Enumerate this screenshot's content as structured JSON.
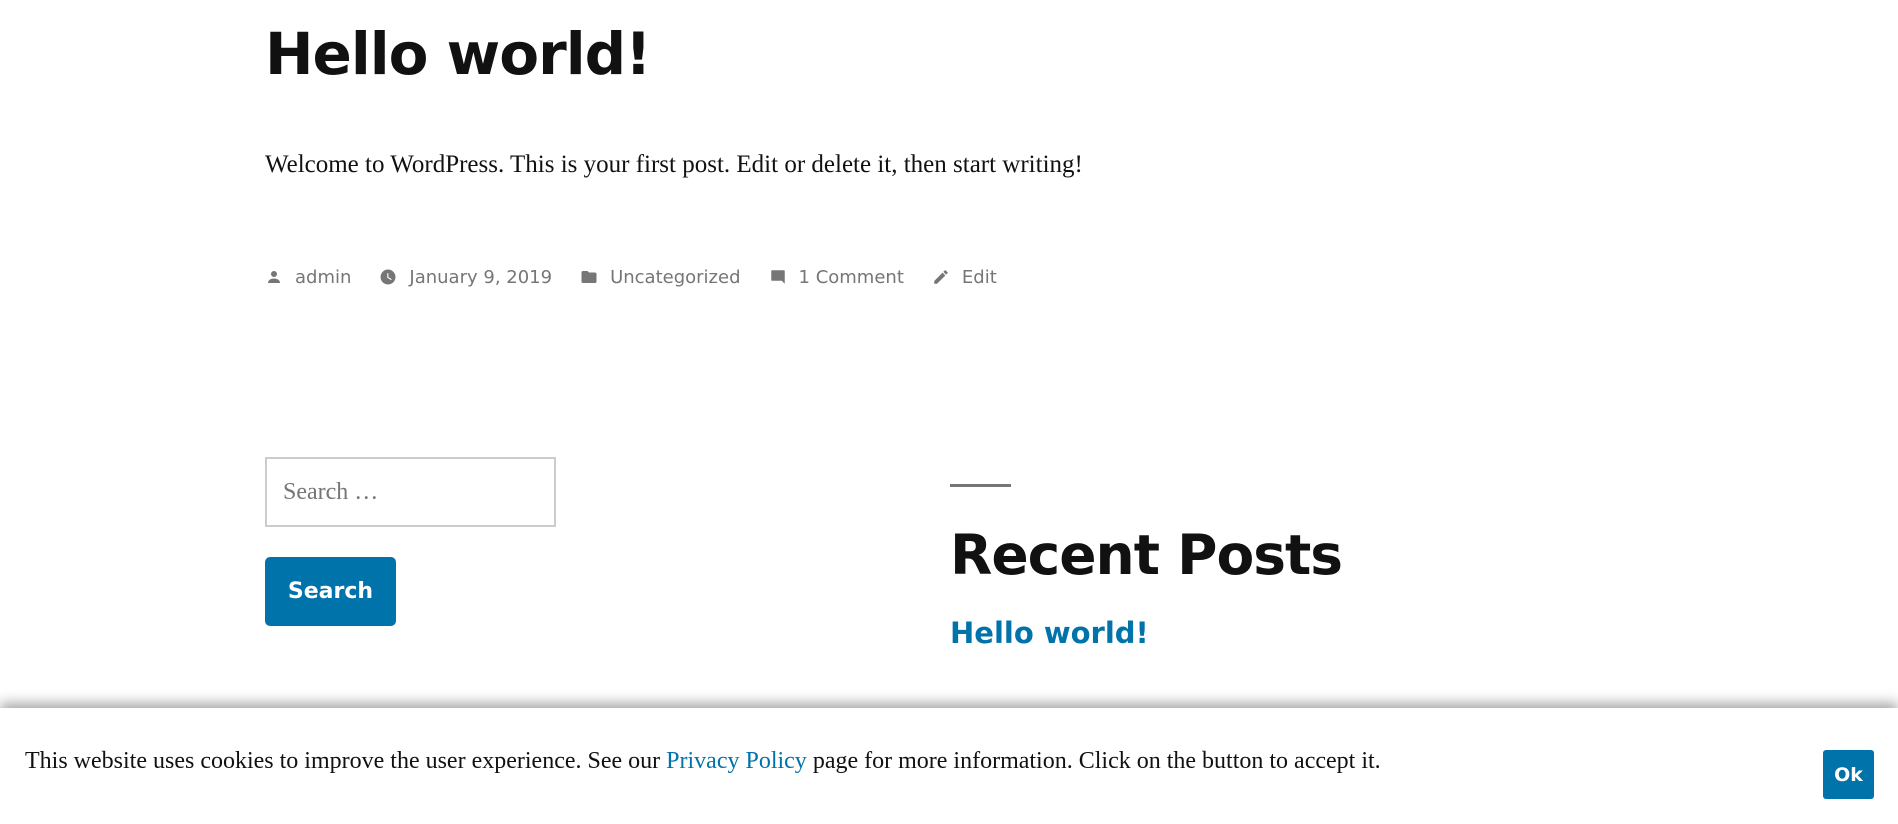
{
  "post": {
    "title": "Hello world!",
    "content": "Welcome to WordPress. This is your first post. Edit or delete it, then start writing!",
    "meta": {
      "author": "admin",
      "date": "January 9, 2019",
      "category": "Uncategorized",
      "comments": "1 Comment",
      "edit": "Edit"
    },
    "meta_icons": [
      "person-icon",
      "clock-icon",
      "folder-icon",
      "comment-icon",
      "pencil-icon"
    ]
  },
  "search_widget": {
    "placeholder": "Search …",
    "button_label": "Search"
  },
  "recent_posts": {
    "title": "Recent Posts",
    "items": [
      {
        "label": "Hello world!"
      }
    ]
  },
  "cookie_banner": {
    "text_before": "This website uses cookies to improve the user experience. See our ",
    "link_label": "Privacy Policy",
    "text_after": " page for more information. Click on the button to accept it.",
    "ok_label": "Ok"
  },
  "colors": {
    "accent": "#0073aa",
    "text": "#111111",
    "meta": "#767676",
    "background": "#ffffff"
  }
}
